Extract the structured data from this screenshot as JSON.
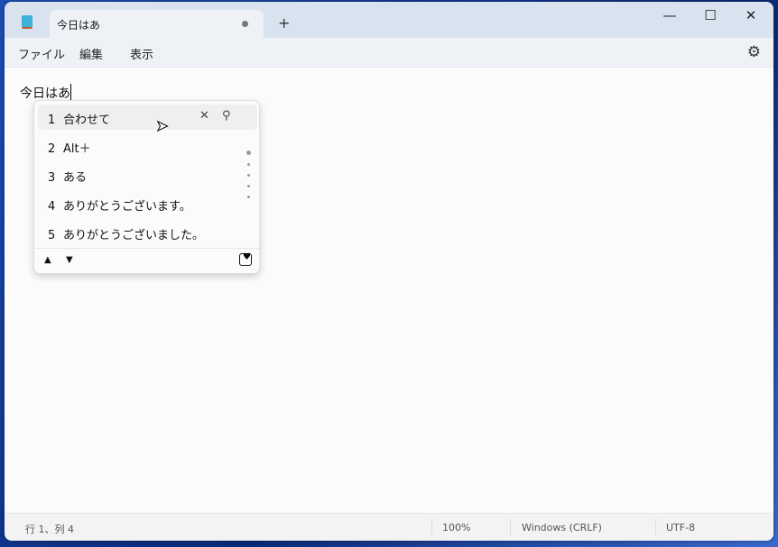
{
  "tab": {
    "title": "今日はあ",
    "unsaved_icon": "dot-icon"
  },
  "new_tab": "+",
  "window_controls": {
    "minimize": "—",
    "maximize": "☐",
    "close": "✕"
  },
  "menu": [
    "ファイル",
    "編集",
    "表示"
  ],
  "settings_icon": "⚙",
  "editor": {
    "text": "今日はあ"
  },
  "ime": {
    "candidates": [
      {
        "n": "1",
        "t": "合わせて"
      },
      {
        "n": "2",
        "t": "Alt＋"
      },
      {
        "n": "3",
        "t": "ある"
      },
      {
        "n": "4",
        "t": "ありがとうございます。"
      },
      {
        "n": "5",
        "t": "ありがとうございました。"
      }
    ],
    "close": "✕",
    "search": "⚲",
    "up": "▲",
    "down": "▼",
    "fav": "♥"
  },
  "status": {
    "position": "行 1、列 4",
    "zoom": "100%",
    "line_ending": "Windows (CRLF)",
    "encoding": "UTF-8"
  }
}
